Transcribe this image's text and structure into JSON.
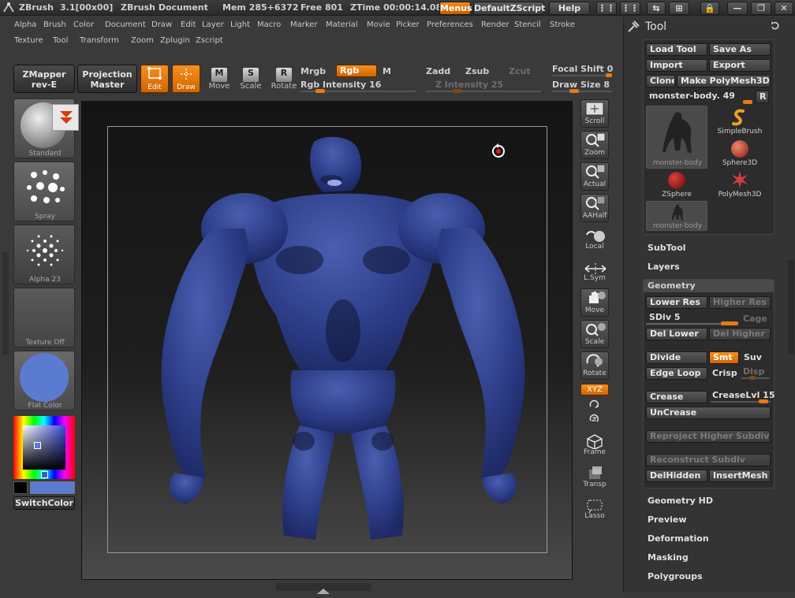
{
  "titlebar": {
    "app": "ZBrush",
    "version": "3.1[00x00]",
    "document": "ZBrush Document",
    "mem": "Mem 285+6372",
    "free": "Free 801",
    "ztime": "ZTime 00:00:14.08",
    "menus_btn": "Menus",
    "script_btn": "DefaultZScript",
    "help_btn": "Help"
  },
  "menus": [
    "Alpha",
    "Brush",
    "Color",
    "Document",
    "Draw",
    "Edit",
    "Layer",
    "Light",
    "Macro",
    "Marker",
    "Material",
    "Movie",
    "Picker",
    "Preferences",
    "Render",
    "Stencil",
    "Stroke",
    "Texture",
    "Tool",
    "Transform",
    "Zoom",
    "Zplugin",
    "Zscript"
  ],
  "toolbar": {
    "zmapper": "ZMapper",
    "zmapper_sub": "rev-E",
    "projection": "Projection",
    "projection_sub": "Master",
    "edit": "Edit",
    "draw": "Draw",
    "move": "Move",
    "scale": "Scale",
    "rotate": "Rotate",
    "mrgb": "Mrgb",
    "rgb": "Rgb",
    "m": "M",
    "rgb_intensity": "Rgb Intensity 16",
    "zadd": "Zadd",
    "zsub": "Zsub",
    "zcut": "Zcut",
    "z_intensity": "Z Intensity 25",
    "focal_shift": "Focal Shift 0",
    "draw_size": "Draw Size 8"
  },
  "left_shelf": {
    "brush": "Standard",
    "stroke": "Spray",
    "alpha": "Alpha 23",
    "texture": "Texture Off",
    "material": "Flat Color",
    "switch_color": "SwitchColor",
    "material_color": "#5a7bd0",
    "secondary_color": "#000000"
  },
  "right_shelf": [
    "Scroll",
    "Zoom",
    "Actual",
    "AAHalf",
    "Local",
    "L.Sym",
    "Move",
    "Scale",
    "Rotate",
    "XYZ",
    "Frame",
    "Transp",
    "Lasso"
  ],
  "tool_panel": {
    "title": "Tool",
    "load_tool": "Load Tool",
    "save_as": "Save As",
    "import": "Import",
    "export": "Export",
    "clone": "Clone",
    "make_polymesh": "Make PolyMesh3D",
    "current_tool": "monster-body. 49",
    "r_btn": "R",
    "tools": [
      "monster-body",
      "SimpleBrush",
      "Sphere3D",
      "ZSphere",
      "PolyMesh3D",
      "monster-body"
    ],
    "subtool": "SubTool",
    "layers": "Layers",
    "geometry": "Geometry",
    "lower_res": "Lower Res",
    "higher_res": "Higher Res",
    "sdiv": "SDiv 5",
    "cage": "Cage",
    "del_lower": "Del Lower",
    "del_higher": "Del Higher",
    "divide": "Divide",
    "smt": "Smt",
    "suv": "Suv",
    "edge_loop": "Edge Loop",
    "crisp": "Crisp",
    "disp": "Disp",
    "crease": "Crease",
    "crease_lvl": "CreaseLvl 15",
    "uncrease": "UnCrease",
    "reproject": "Reproject Higher Subdiv",
    "reconstruct": "Reconstruct Subdiv",
    "delhidden": "DelHidden",
    "insertmesh": "InsertMesh",
    "geometry_hd": "Geometry HD",
    "preview": "Preview",
    "deformation": "Deformation",
    "masking": "Masking",
    "polygroups": "Polygroups"
  }
}
